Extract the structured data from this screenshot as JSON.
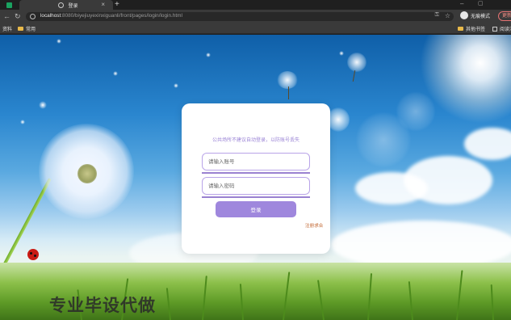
{
  "browser": {
    "tab_title": "登录",
    "url_host": "localhost",
    "url_path": ":8080/biyejiuyexinxiguanli/front/pages/login/login.html",
    "incognito_label": "无痕模式",
    "update_label": "更新"
  },
  "bookmarks": {
    "left": [
      {
        "label": "资料"
      },
      {
        "label": "常用"
      }
    ],
    "right": [
      {
        "label": "其他书签"
      },
      {
        "label": "阅读清单"
      }
    ]
  },
  "login": {
    "notice": "公共场所不建议自动登录，以防账号丢失",
    "username_placeholder": "请输入账号",
    "password_placeholder": "请输入密码",
    "login_label": "登录",
    "register_label": "注册求合"
  },
  "watermark": "专业毕设代做",
  "colors": {
    "accent": "#9f87dd",
    "input_border": "#b9a4e8",
    "link": "#c0622a"
  }
}
